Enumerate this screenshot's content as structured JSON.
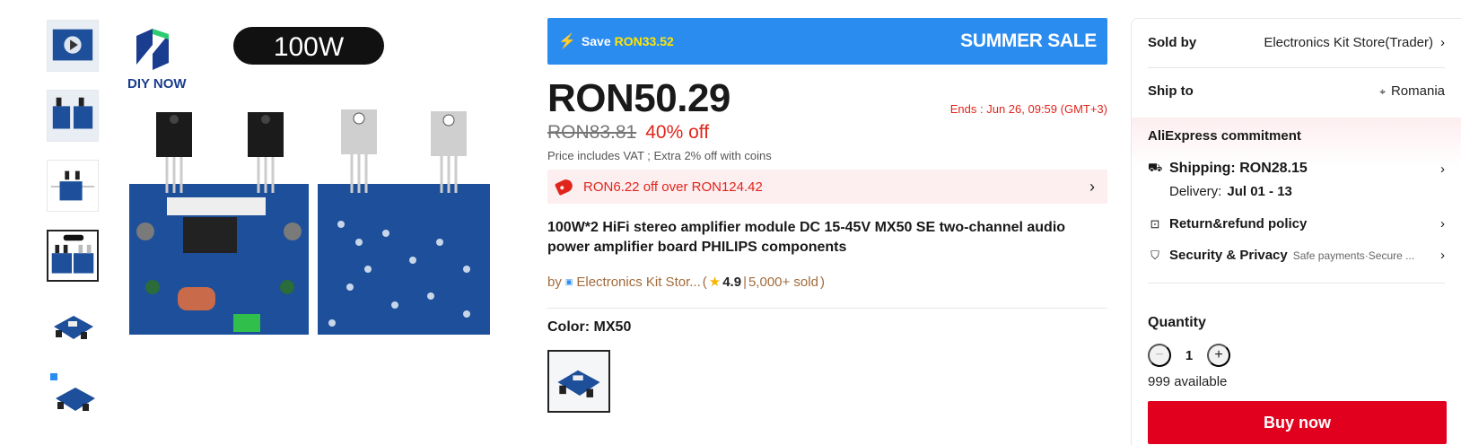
{
  "gallery": {
    "thumbnails": [
      {
        "name": "thumb-video"
      },
      {
        "name": "thumb-boards"
      },
      {
        "name": "thumb-diagram"
      },
      {
        "name": "thumb-main"
      },
      {
        "name": "thumb-angle-1"
      },
      {
        "name": "thumb-angle-2"
      }
    ],
    "active_index": 3,
    "main_image": {
      "brand": "DIY NOW",
      "badge": "100W"
    }
  },
  "promo": {
    "save_label": "Save",
    "save_value": "RON33.52",
    "event": "SUMMER SALE"
  },
  "pricing": {
    "price": "RON50.29",
    "ends": "Ends :  Jun 26, 09:59 (GMT+3)",
    "old_price": "RON83.81",
    "discount": "40% off",
    "vat_note": "Price includes VAT ; Extra 2% off with coins",
    "coupon": "RON6.22 off over RON124.42"
  },
  "product": {
    "title": "100W*2 HiFi stereo amplifier module DC 15-45V MX50 SE two-channel audio power amplifier board PHILIPS components",
    "by": "by",
    "store_short": "Electronics Kit Stor...",
    "rating": "4.9",
    "sold": "5,000+ sold",
    "color_label": "Color: MX50"
  },
  "sidebar": {
    "sold_by_label": "Sold by",
    "sold_by_value": "Electronics Kit Store(Trader)",
    "ship_to_label": "Ship to",
    "ship_to_value": "Romania",
    "commitment": "AliExpress commitment",
    "shipping": "Shipping: RON28.15",
    "delivery_label": "Delivery:",
    "delivery_value": "Jul 01 - 13",
    "return_policy": "Return&refund policy",
    "security": "Security & Privacy",
    "security_note": "Safe payments·Secure ...",
    "quantity_label": "Quantity",
    "quantity": "1",
    "available": "999 available",
    "buy_now": "Buy now"
  },
  "colors": {
    "accent": "#e1001e",
    "banner": "#2b8cf0",
    "price_red": "#e1251b",
    "board_blue": "#1d4f9a"
  },
  "icons": [
    "play-icon",
    "bolt-icon",
    "coupon-tag-icon",
    "chevron-right-icon",
    "location-pin-icon",
    "truck-icon",
    "refund-icon",
    "shield-icon",
    "minus-icon",
    "plus-icon",
    "star-icon"
  ]
}
